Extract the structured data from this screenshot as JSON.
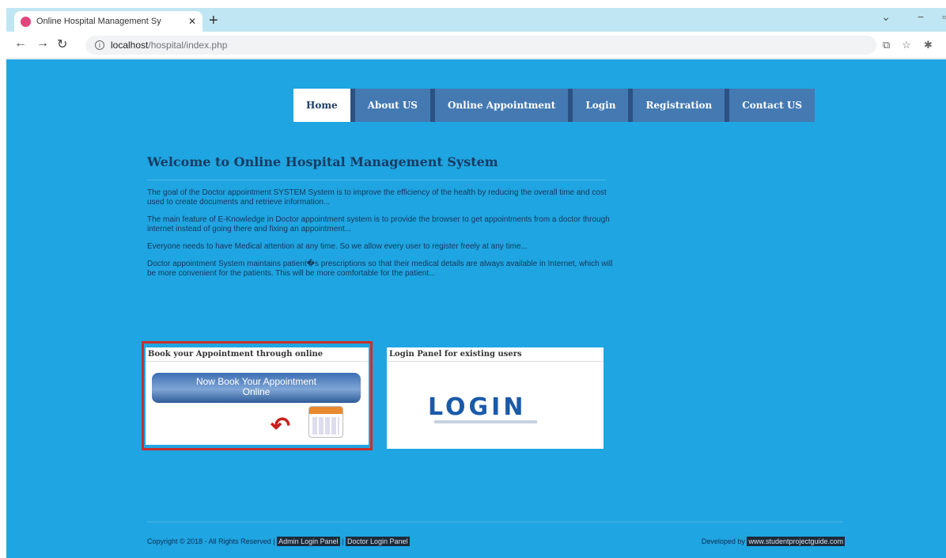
{
  "browser": {
    "tab_title": "Online Hospital Management Sy",
    "url_host": "localhost",
    "url_path": "/hospital/index.php"
  },
  "nav": {
    "items": [
      {
        "label": "Home",
        "active": true
      },
      {
        "label": "About US"
      },
      {
        "label": "Online Appointment"
      },
      {
        "label": "Login"
      },
      {
        "label": "Registration"
      },
      {
        "label": "Contact US"
      }
    ]
  },
  "main": {
    "title": "Welcome to Online Hospital Management System",
    "paragraphs": [
      "The goal of the Doctor appointment SYSTEM System is to improve the efficiency of the health by reducing the overall time and cost used to create documents and retrieve information...",
      "The main feature of E-Knowledge in Doctor appointment system is to provide the browser to get appointments from a doctor through internet instead of going there and fixing an appointment...",
      "Everyone needs to have Medical attention at any time. So we allow every user to register freely at any time...",
      "Doctor appointment System maintains patient�s prescriptions so that their medical details are always available in Internet, which will be more convenient for the patients. This will be more comfortable for the patient..."
    ]
  },
  "boxes": {
    "book": {
      "heading": "Book your Appointment through online",
      "banner_line1": "Now Book Your Appointment",
      "banner_line2": "Online"
    },
    "login": {
      "heading": "Login Panel for existing users",
      "logo_text": "LOGIN"
    }
  },
  "footer": {
    "copyright": "Copyright © 2018 - All Rights Reserved |",
    "admin_link": "Admin Login Panel",
    "separator": "|",
    "doctor_link": "Doctor Login Panel",
    "developed_by": "Developed by",
    "site_link": "www.studentprojectguide.com"
  },
  "colors": {
    "page_bg": "#1fa5e1",
    "nav_bg": "#4479b2",
    "highlight": "#c9302c"
  }
}
